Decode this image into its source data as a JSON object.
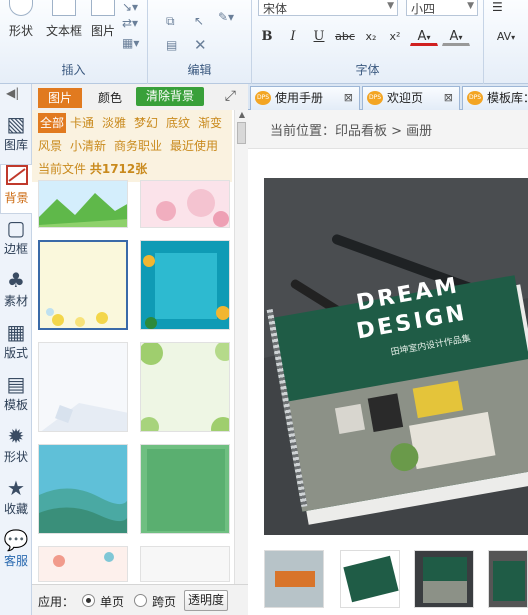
{
  "ribbon": {
    "insert_group": {
      "label": "插入",
      "shape_label": "形状",
      "textbox_label": "文本框",
      "image_label": "图片"
    },
    "edit_group": {
      "label": "编辑"
    },
    "font_group": {
      "label": "字体",
      "font_family": "宋体",
      "font_size": "小四",
      "bold": "B",
      "italic": "I",
      "underline": "U",
      "strike": "abc",
      "subscript": "x₂",
      "superscript": "x²",
      "font_color": "A",
      "highlight": "A",
      "char_spacing": "AV"
    }
  },
  "sidenav": {
    "items": [
      {
        "label": "图库",
        "icon": "gallery-icon"
      },
      {
        "label": "背景",
        "icon": "background-icon"
      },
      {
        "label": "边框",
        "icon": "border-icon"
      },
      {
        "label": "素材",
        "icon": "material-icon"
      },
      {
        "label": "版式",
        "icon": "layout-icon"
      },
      {
        "label": "模板",
        "icon": "template-icon"
      },
      {
        "label": "形状",
        "icon": "shape-icon"
      },
      {
        "label": "收藏",
        "icon": "star-icon"
      },
      {
        "label": "客服",
        "icon": "chat-icon"
      }
    ],
    "active": "背景"
  },
  "panel": {
    "tabs": [
      "图片",
      "颜色"
    ],
    "clear_button": "清除背景",
    "categories": [
      "全部",
      "卡通",
      "淡雅",
      "梦幻",
      "底纹",
      "渐变",
      "风景",
      "小清新",
      "商务职业",
      "最近使用"
    ],
    "count_prefix": "当前文件",
    "count_value": "共1712张",
    "apply_label": "应用：",
    "single_label": "单页",
    "spread_label": "跨页",
    "transparency_button": "透明度"
  },
  "doctabs": [
    {
      "title": "使用手册",
      "close": "⊠"
    },
    {
      "title": "欢迎页",
      "close": "⊠"
    },
    {
      "title": "模板库：",
      "close": ""
    }
  ],
  "main": {
    "breadcrumb": "当前位置：印品看板 > 画册",
    "cover_title_1": "DREAM",
    "cover_title_2": "DESIGN",
    "cover_subtitle": "田坤室内设计作品集"
  },
  "colors": {
    "accent_orange": "#e17a1f",
    "clear_green": "#39a03a",
    "selected_border": "#3a6aa8"
  }
}
